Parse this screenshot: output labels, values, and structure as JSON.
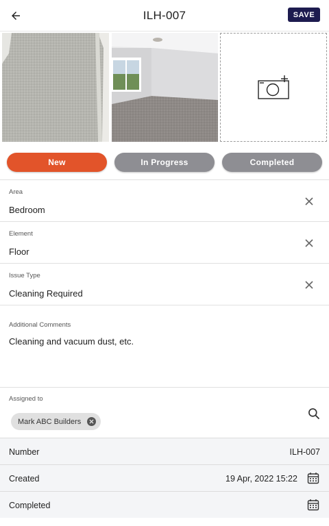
{
  "header": {
    "title": "ILH-007",
    "save_label": "SAVE",
    "back_icon": "arrow-left-icon"
  },
  "photos": [
    {
      "name": "photo-carpet-closeup"
    },
    {
      "name": "photo-bedroom-floor"
    }
  ],
  "add_photo_icon": "camera-plus-icon",
  "status": {
    "new": "New",
    "in_progress": "In Progress",
    "completed": "Completed",
    "selected": "New",
    "selected_color": "#e2542a",
    "unselected_color": "#8e8e93"
  },
  "fields": {
    "area": {
      "label": "Area",
      "value": "Bedroom"
    },
    "element": {
      "label": "Element",
      "value": "Floor"
    },
    "issue_type": {
      "label": "Issue Type",
      "value": "Cleaning Required"
    },
    "comments": {
      "label": "Additional Comments",
      "value": "Cleaning and vacuum dust, etc."
    },
    "assigned": {
      "label": "Assigned to",
      "chip": "Mark ABC Builders"
    }
  },
  "info": {
    "number": {
      "label": "Number",
      "value": "ILH-007"
    },
    "created": {
      "label": "Created",
      "value": "19 Apr, 2022 15:22"
    },
    "completed": {
      "label": "Completed",
      "value": ""
    }
  },
  "colors": {
    "save_button": "#1d1b4f",
    "accent": "#e2542a"
  }
}
